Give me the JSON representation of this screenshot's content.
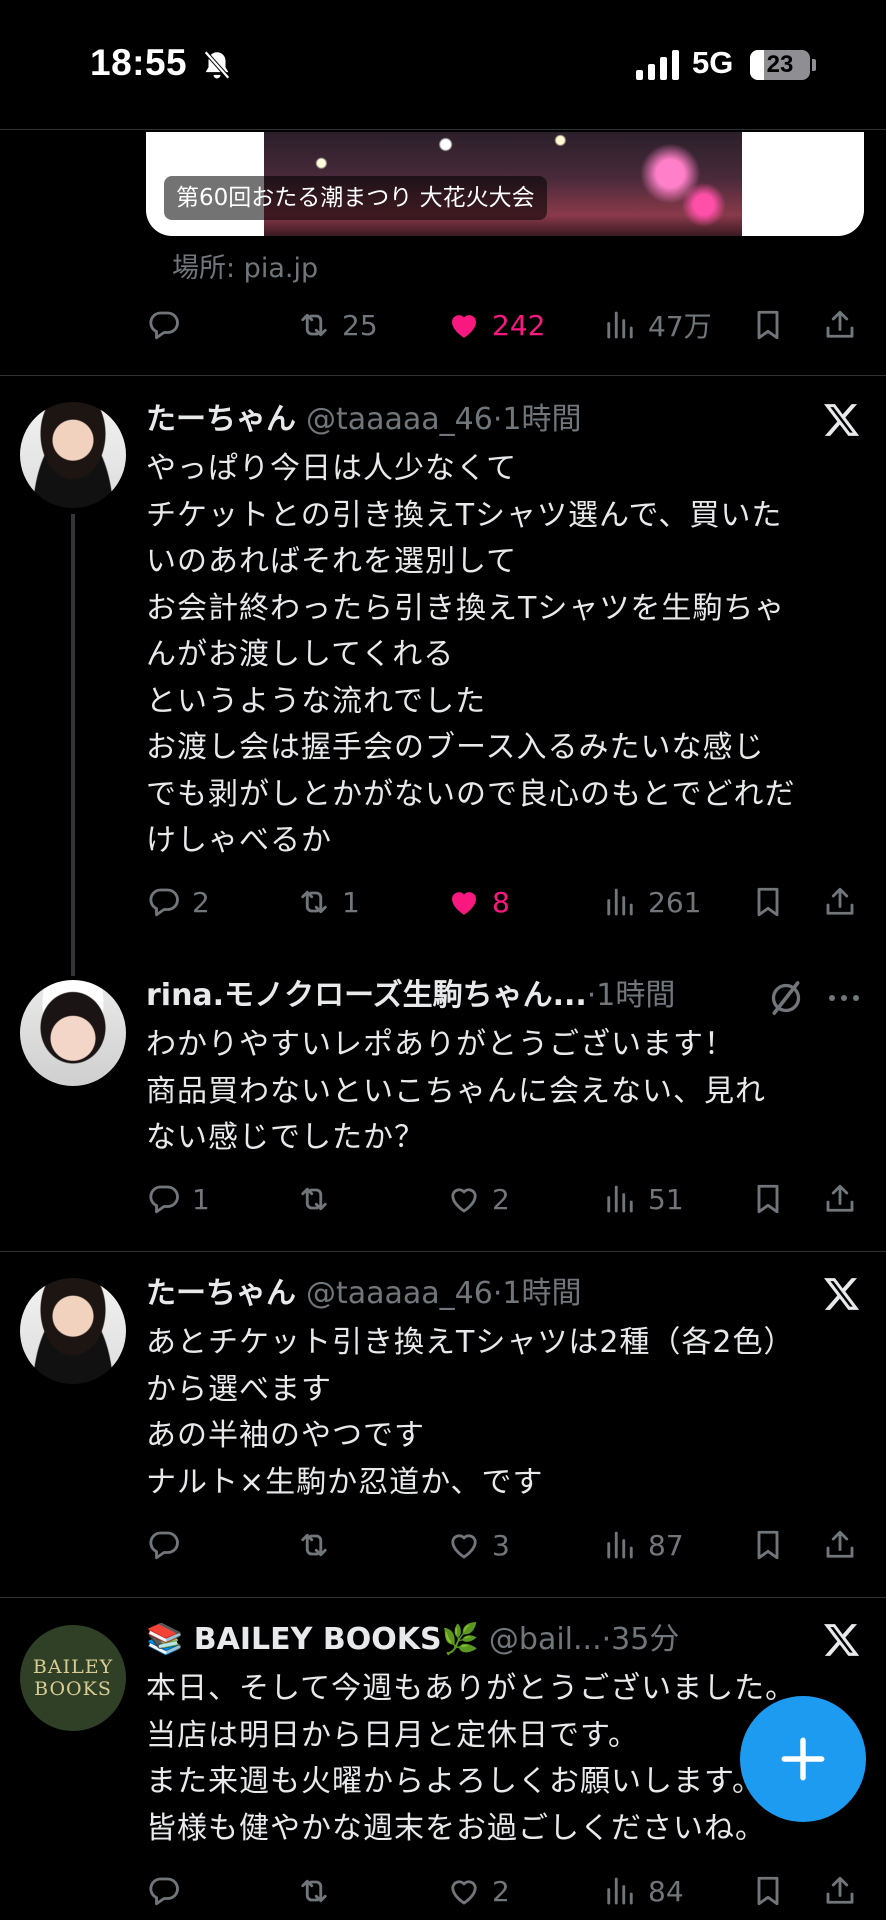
{
  "status_bar": {
    "time": "18:55",
    "network": "5G",
    "battery": "23",
    "battery_fraction": 0.23
  },
  "post0": {
    "card_title": "第60回おたる潮まつり 大花火大会",
    "source": "場所: pia.jp",
    "stats": {
      "retweets": "25",
      "likes": "242",
      "views": "47万"
    }
  },
  "post1": {
    "name": "たーちゃん",
    "handle": "@taaaaa_46",
    "time": "·1時間",
    "body": "やっぱり今日は人少なくて\nチケットとの引き換えTシャツ選んで、買いた\nいのあればそれを選別して\nお会計終わったら引き換えTシャツを生駒ちゃ\nんがお渡ししてくれる\nというような流れでした\nお渡し会は握手会のブース入るみたいな感じ\nでも剥がしとかがないので良心のもとでどれだ\nけしゃべるか",
    "stats": {
      "replies": "2",
      "retweets": "1",
      "likes": "8",
      "views": "261"
    }
  },
  "post2": {
    "name": "rina.モノクローズ生駒ちゃん...",
    "time": "·1時間",
    "body": "わかりやすいレポありがとうございます！\n商品買わないといこちゃんに会えない、見れ\nない感じでしたか？",
    "stats": {
      "replies": "1",
      "likes": "2",
      "views": "51"
    }
  },
  "post3": {
    "name": "たーちゃん",
    "handle": "@taaaaa_46",
    "time": "·1時間",
    "body": "あとチケット引き換えTシャツは2種（各2色）\nから選べます\nあの半袖のやつです\nナルト×生駒か忍道か、です",
    "stats": {
      "likes": "3",
      "views": "87"
    }
  },
  "post4": {
    "name": "📚 BAILEY BOOKS🌿",
    "handle": "@bail...",
    "time": "·35分",
    "avatar_text": "BAILEY BOOKS",
    "body": "本日、そして今週もありがとうございました。\n当店は明日から日月と定休日です。\nまた来週も火曜からよろしくお願いします。\n皆様も健やかな週末をお過ごしくださいね。",
    "stats": {
      "likes": "2",
      "views": "84"
    }
  },
  "icons": {
    "reply": "reply-icon",
    "retweet": "retweet-icon",
    "like": "heart-icon",
    "views": "views-icon",
    "bookmark": "bookmark-icon",
    "share": "share-icon",
    "x": "x-logo-icon",
    "compose": "plus-icon"
  },
  "colors": {
    "accent": "#1d9bf0",
    "like": "#f91880",
    "muted": "#71767b",
    "background": "#000000"
  }
}
